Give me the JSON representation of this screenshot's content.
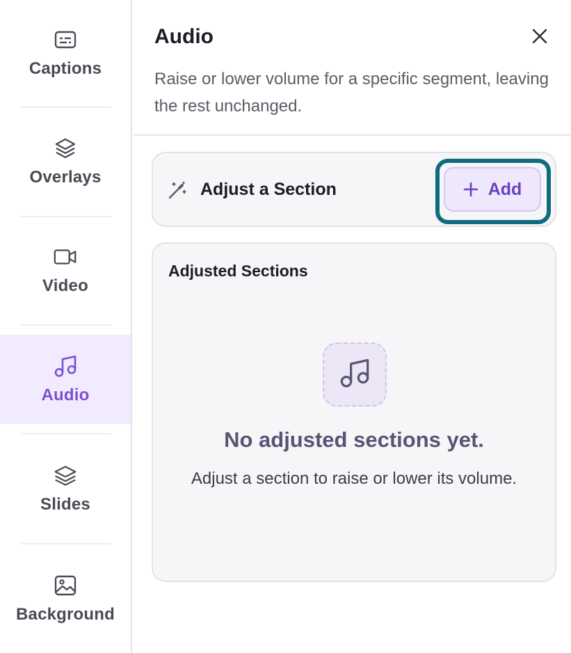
{
  "sidebar": {
    "items": [
      {
        "label": "Captions",
        "icon": "captions-icon"
      },
      {
        "label": "Overlays",
        "icon": "layers-icon"
      },
      {
        "label": "Video",
        "icon": "video-camera-icon"
      },
      {
        "label": "Audio",
        "icon": "music-note-icon",
        "active": true
      },
      {
        "label": "Slides",
        "icon": "stack-icon"
      },
      {
        "label": "Background",
        "icon": "image-icon"
      }
    ]
  },
  "panel": {
    "title": "Audio",
    "description": "Raise or lower volume for a specific segment, leaving the rest unchanged.",
    "adjust": {
      "title": "Adjust a Section",
      "add_label": "Add"
    },
    "sections": {
      "title": "Adjusted Sections",
      "empty_title": "No adjusted sections yet.",
      "empty_description": "Adjust a section to raise or lower its volume."
    }
  },
  "colors": {
    "accent": "#7a4fd6",
    "highlight": "#0f6c80",
    "active_bg": "#f1ebfd"
  }
}
